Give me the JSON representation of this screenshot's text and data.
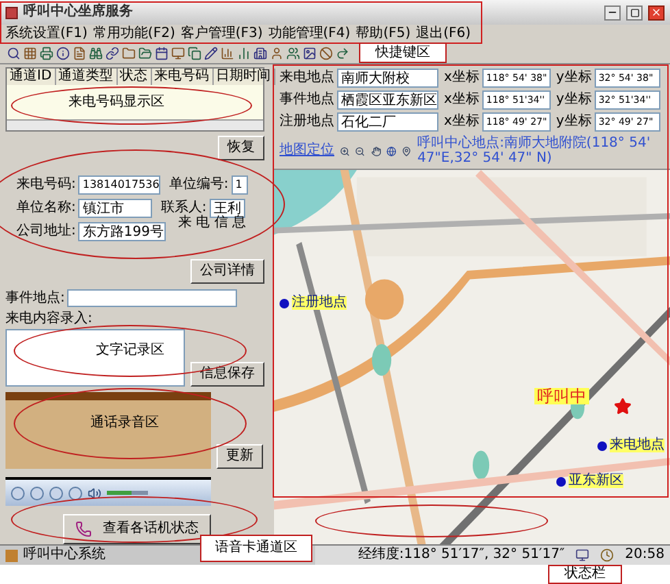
{
  "window": {
    "title": "呼叫中心坐席服务"
  },
  "menu": [
    {
      "label": "系统设置(F1)"
    },
    {
      "label": "常用功能(F2)"
    },
    {
      "label": "客户管理(F3)"
    },
    {
      "label": "功能管理(F4)"
    },
    {
      "label": "帮助(F5)"
    },
    {
      "label": "退出(F6)"
    }
  ],
  "call_table": {
    "columns": [
      "通道ID",
      "通道类型",
      "状态",
      "来电号码",
      "日期时间"
    ]
  },
  "restore_button": "恢复",
  "caller_form": {
    "fields": [
      {
        "label": "来电号码:",
        "value": "13814017536"
      },
      {
        "label": "单位编号:",
        "value": "1"
      },
      {
        "label": "单位名称:",
        "value": "镇江市"
      },
      {
        "label": "联系人:",
        "value": "王利"
      },
      {
        "label": "公司地址:",
        "value": "东方路199号"
      }
    ],
    "details_button": "公司详情"
  },
  "event_place": {
    "label": "事件地点:"
  },
  "call_content": {
    "label": "来电内容录入:"
  },
  "save_button": "信息保存",
  "update_button": "更新",
  "player": {
    "volume": {
      "level": 0.6
    }
  },
  "phone_status_button": "查看各话机状态",
  "taskbar": {
    "item": "呼叫中心系统"
  },
  "locations": [
    {
      "label": "来电地点",
      "name": "南师大附校",
      "x_label": "x坐标",
      "x": "118° 54' 38\"",
      "y_label": "y坐标",
      "y": "32° 54' 38\""
    },
    {
      "label": "事件地点",
      "name": "栖霞区亚东新区",
      "x_label": "x坐标",
      "x": "118° 51'34''",
      "y_label": "y坐标",
      "y": "32° 51'34''"
    },
    {
      "label": "注册地点",
      "name": "石化二厂",
      "x_label": "x坐标",
      "x": "118° 49' 27\"",
      "y_label": "y坐标",
      "y": "32° 49' 27\""
    }
  ],
  "map_toolbar": {
    "link": "地图定位",
    "center": "呼叫中心地点:南师大地附院(118° 54' 47\"E,32° 54' 47\" N)"
  },
  "map_markers": [
    {
      "kind": "dot",
      "label": "注册地点"
    },
    {
      "kind": "center",
      "label": "呼叫中"
    },
    {
      "kind": "dot",
      "label": "来电地点"
    },
    {
      "kind": "dot",
      "label": "亚东新区"
    }
  ],
  "status_bar": {
    "coords": "经纬度:118° 51′17″, 32° 51′17″",
    "time": "20:58"
  },
  "annotations": [
    {
      "kind": "frame"
    },
    {
      "kind": "frame"
    },
    {
      "kind": "callout",
      "label": "快捷键区"
    },
    {
      "kind": "ellipse",
      "label": "来电号码显示区"
    },
    {
      "kind": "ellipse",
      "label": "来 电 信 息"
    },
    {
      "kind": "ellipse",
      "label": "文字记录区"
    },
    {
      "kind": "ellipse",
      "label": "通话录音区"
    },
    {
      "kind": "ellipse"
    },
    {
      "kind": "ellipse"
    },
    {
      "kind": "callout",
      "label": "语音卡通道区"
    },
    {
      "kind": "callout",
      "label": "状态栏"
    }
  ]
}
